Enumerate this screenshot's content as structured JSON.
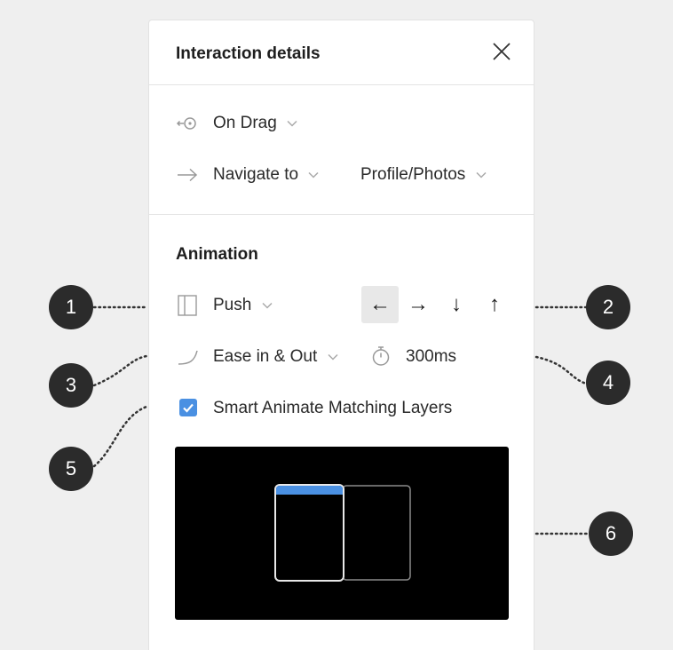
{
  "panel": {
    "title": "Interaction details"
  },
  "trigger": {
    "label": "On Drag",
    "icon": "drag-trigger-icon"
  },
  "action": {
    "label": "Navigate to",
    "destination": "Profile/Photos",
    "icon": "arrow-right-icon"
  },
  "animation": {
    "heading": "Animation",
    "transition": "Push",
    "directions": [
      {
        "glyph": "←",
        "name": "direction-left-button",
        "selected": true
      },
      {
        "glyph": "→",
        "name": "direction-right-button",
        "selected": false
      },
      {
        "glyph": "↓",
        "name": "direction-down-button",
        "selected": false
      },
      {
        "glyph": "↑",
        "name": "direction-up-button",
        "selected": false
      }
    ],
    "easing": "Ease in & Out",
    "duration": "300ms",
    "smart_animate_label": "Smart Animate Matching Layers",
    "smart_animate_checked": true
  },
  "callouts": [
    "1",
    "2",
    "3",
    "4",
    "5",
    "6"
  ],
  "colors": {
    "accent": "#4a90e2",
    "callout": "#2b2b2b",
    "preview_bg": "#000000"
  }
}
